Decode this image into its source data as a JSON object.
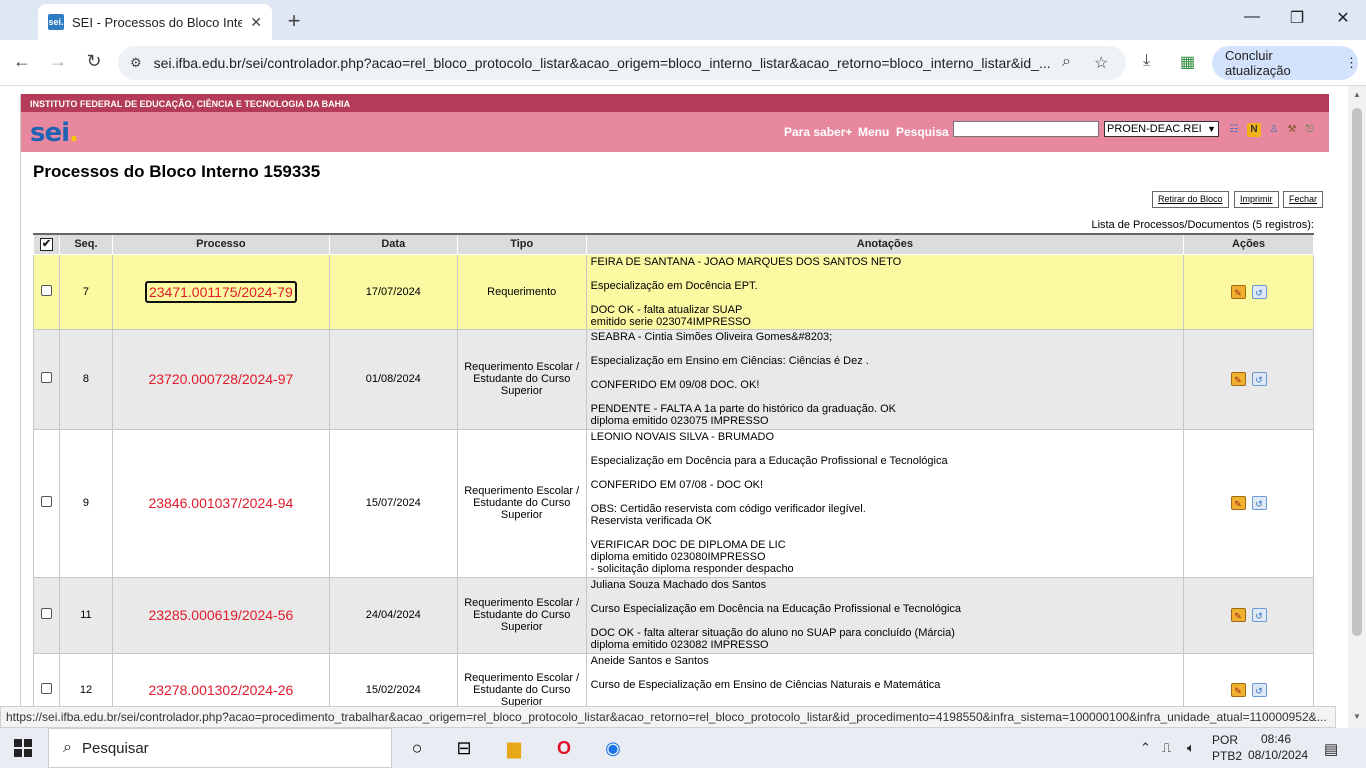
{
  "browser": {
    "tab_title": "SEI - Processos do Bloco Interno",
    "favicon_text": "sei.",
    "url": "sei.ifba.edu.br/sei/controlador.php?acao=rel_bloco_protocolo_listar&acao_origem=bloco_interno_listar&acao_retorno=bloco_interno_listar&id_...",
    "update_button": "Concluir atualização"
  },
  "sei": {
    "institution": "INSTITUTO FEDERAL DE EDUCAÇÃO, CIÊNCIA E TECNOLOGIA DA BAHIA",
    "logo": "sei",
    "logo_dot": ".",
    "nav_para_saber": "Para saber+",
    "nav_menu": "Menu",
    "nav_pesquisa": "Pesquisa",
    "unit": "PROEN-DEAC.REI",
    "page_title": "Processos do Bloco Interno 159335",
    "buttons": {
      "retirar": "Retirar do Bloco",
      "imprimir": "Imprimir",
      "fechar": "Fechar"
    },
    "list_caption": "Lista de Processos/Documentos (5 registros):",
    "columns": {
      "seq": "Seq.",
      "processo": "Processo",
      "data": "Data",
      "tipo": "Tipo",
      "anotacoes": "Anotações",
      "acoes": "Ações"
    },
    "rows": [
      {
        "seq": "7",
        "processo": "23471.001175/2024-79",
        "data": "17/07/2024",
        "tipo": "Requerimento",
        "anotacoes": [
          "FEIRA DE SANTANA - JOAO MARQUES DOS SANTOS NETO",
          "",
          "Especialização em Docência EPT.",
          "",
          "DOC OK - falta atualizar SUAP",
          "emitido serie 023074IMPRESSO"
        ]
      },
      {
        "seq": "8",
        "processo": "23720.000728/2024-97",
        "data": "01/08/2024",
        "tipo": "Requerimento Escolar / Estudante do Curso Superior",
        "anotacoes": [
          "SEABRA - Cintia Simões Oliveira Gomes&#8203;",
          "",
          "Especialização em Ensino em Ciências: Ciências é Dez .",
          "",
          "CONFERIDO EM 09/08 DOC. OK!",
          "",
          "PENDENTE - FALTA A 1a parte do histórico da graduação. OK",
          "diploma emitido 023075 IMPRESSO"
        ]
      },
      {
        "seq": "9",
        "processo": "23846.001037/2024-94",
        "data": "15/07/2024",
        "tipo": "Requerimento Escolar / Estudante do Curso Superior",
        "anotacoes": [
          "LEONIO NOVAIS SILVA - BRUMADO",
          "",
          "Especialização em Docência para a Educação Profissional e Tecnológica",
          "",
          "CONFERIDO EM 07/08 - DOC OK!",
          "",
          "OBS: Certidão reservista com código verificador ilegível.",
          "Reservista verificada OK",
          "",
          "VERIFICAR DOC DE DIPLOMA DE LIC",
          "diploma emitido 023080IMPRESSO",
          "- solicitação diploma responder despacho"
        ]
      },
      {
        "seq": "11",
        "processo": "23285.000619/2024-56",
        "data": "24/04/2024",
        "tipo": "Requerimento Escolar / Estudante do Curso Superior",
        "anotacoes": [
          "Juliana Souza Machado dos Santos",
          "",
          "Curso Especialização em Docência na Educação Profissional e Tecnológica",
          "",
          "DOC OK - falta alterar situação do aluno no SUAP para concluído (Márcia)",
          "diploma emitido 023082 IMPRESSO"
        ]
      },
      {
        "seq": "12",
        "processo": "23278.001302/2024-26",
        "data": "15/02/2024",
        "tipo": "Requerimento Escolar / Estudante do Curso Superior",
        "anotacoes": [
          "Aneide Santos e Santos",
          "",
          "Curso de Especialização em Ensino de Ciências Naturais e Matemática",
          "",
          ""
        ]
      }
    ]
  },
  "status_url": "https://sei.ifba.edu.br/sei/controlador.php?acao=procedimento_trabalhar&acao_origem=rel_bloco_protocolo_listar&acao_retorno=rel_bloco_protocolo_listar&id_procedimento=4198550&infra_sistema=100000100&infra_unidade_atual=110000952&...",
  "taskbar": {
    "search_placeholder": "Pesquisar",
    "lang_top": "POR",
    "lang_bottom": "PTB2",
    "time": "08:46",
    "date": "08/10/2024"
  },
  "colors": {
    "header_pink": "#e7889e",
    "institution_bar": "#b53b5a",
    "process_link_red": "#e11b2b",
    "selected_row_yellow": "#fbf9a2"
  }
}
